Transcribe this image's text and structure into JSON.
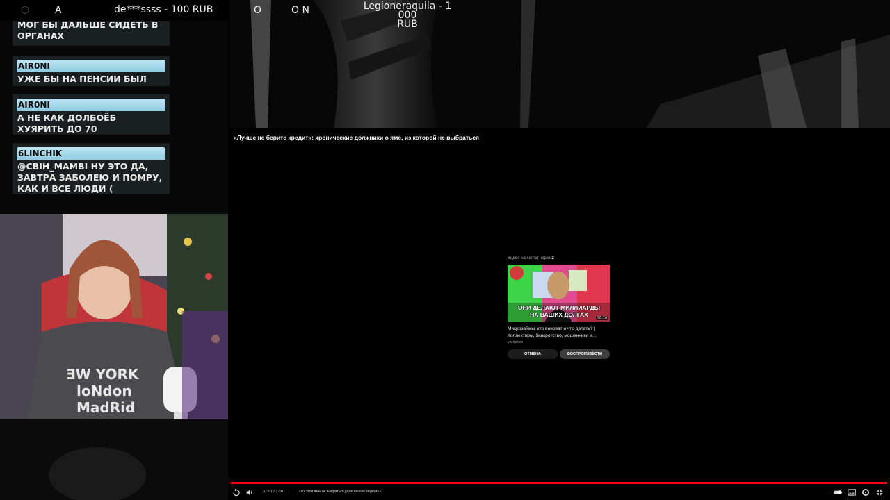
{
  "ticker": {
    "items": [
      "A",
      "de***ssss - 100 RUB",
      "O",
      "O N"
    ],
    "donation_line1": "Legioneraquila - 1 000",
    "donation_line2": "RUB"
  },
  "chat": {
    "messages": [
      {
        "user": "",
        "text": "МОГ БЫ ДАЛЬШЕ СИДЕТЬ В ОРГАНАХ"
      },
      {
        "user": "AIR0NI",
        "text": "УЖЕ БЫ НА ПЕНСИИ БЫЛ"
      },
      {
        "user": "AIR0NI",
        "text": "А НЕ КАК ДОЛБОЁБ ХУЯРИТЬ ДО 70"
      },
      {
        "user": "6LINCHIK",
        "text": "@CBIH_MAMBI НУ ЭТО ДА, ЗАВТРА ЗАБОЛЕЮ И ПОМРУ, КАК И ВСЕ ЛЮДИ ("
      }
    ]
  },
  "webcam": {
    "shirt_text": "NEW YORK London Madrid"
  },
  "player": {
    "title": "«Лучше не берите кредит»: хронические должники о яме, из которой не выбраться",
    "up_next": {
      "countdown_label": "Видео начнется через",
      "countdown_value": "3",
      "thumbnail_caption_1": "ОНИ ДЕЛАЮТ МИЛЛИАРДЫ",
      "thumbnail_caption_2": "НА ВАШИХ ДОЛГАХ",
      "duration": "50:16",
      "title": "Микрозаймы: кто виноват и что делать? | Коллекторы, банкротство, мошенники и…",
      "channel": "varlamov",
      "cancel_label": "ОТМЕНА",
      "play_label": "ВОСПРОИЗВЕСТИ"
    },
    "progress": 1.0,
    "time": "37:01 / 37:01",
    "chapter": "«Из этой ямы не выбраться даже вашим внукам» ›"
  },
  "colors": {
    "progress": "#ff0000",
    "username_bg": "#a9dcef",
    "chat_bg": "#1a1f22"
  }
}
